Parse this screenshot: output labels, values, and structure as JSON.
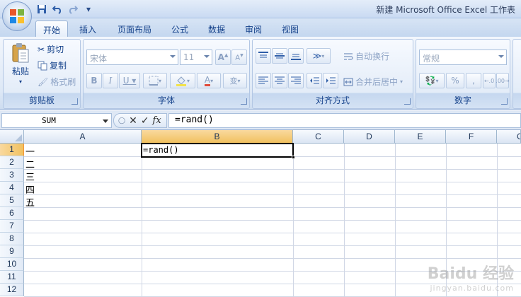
{
  "window": {
    "title": "新建 Microsoft Office Excel 工作表"
  },
  "tabs": [
    {
      "label": "开始",
      "active": true
    },
    {
      "label": "插入"
    },
    {
      "label": "页面布局"
    },
    {
      "label": "公式"
    },
    {
      "label": "数据"
    },
    {
      "label": "审阅"
    },
    {
      "label": "视图"
    }
  ],
  "clipboard": {
    "label": "剪贴板",
    "paste": "粘贴",
    "cut": "剪切",
    "copy": "复制",
    "format_painter": "格式刷"
  },
  "font": {
    "label": "字体",
    "font_name": "宋体",
    "font_size": "11"
  },
  "alignment": {
    "label": "对齐方式",
    "wrap_text": "自动换行",
    "merge_center": "合并后居中"
  },
  "number": {
    "label": "数字",
    "format": "常规"
  },
  "formula_bar": {
    "name_box": "SUM",
    "formula": "=rand()"
  },
  "sheet": {
    "columns": [
      "A",
      "B",
      "C",
      "D",
      "E",
      "F",
      "G"
    ],
    "rows": [
      "1",
      "2",
      "3",
      "4",
      "5",
      "6",
      "7",
      "8",
      "9",
      "10",
      "11",
      "12"
    ],
    "selected_column": "B",
    "selected_row": "1",
    "cells": {
      "A1": "一",
      "A2": "二",
      "A3": "三",
      "A4": "四",
      "A5": "五",
      "B1": "=rand()"
    }
  },
  "watermark": {
    "brand": "Baidu 经验",
    "url": "jingyan.baidu.com"
  },
  "colors": {
    "selection_header": "#f1c15f",
    "ribbon_text": "#15428b",
    "grid_line": "#d0d7e5"
  }
}
